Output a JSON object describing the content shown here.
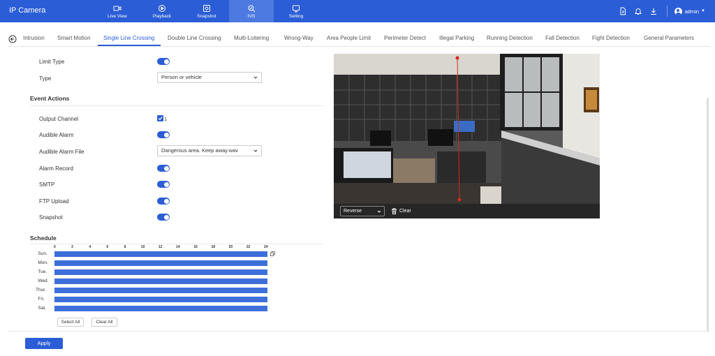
{
  "app": {
    "title": "IP Camera"
  },
  "nav": [
    {
      "label": "Live View",
      "icon": "video-icon"
    },
    {
      "label": "Playback",
      "icon": "playback-icon"
    },
    {
      "label": "Snapshot",
      "icon": "snapshot-icon"
    },
    {
      "label": "IVS",
      "icon": "ivs-icon",
      "active": true
    },
    {
      "label": "Setting",
      "icon": "settings-icon"
    }
  ],
  "user": {
    "name": "admin"
  },
  "tabs": [
    {
      "label": "Intrusion"
    },
    {
      "label": "Smart Motion"
    },
    {
      "label": "Single Line Crossing",
      "active": true
    },
    {
      "label": "Double Line Crossing"
    },
    {
      "label": "Multi-Loitering"
    },
    {
      "label": "Wrong-Way"
    },
    {
      "label": "Area People Limit"
    },
    {
      "label": "Perimeter Detect"
    },
    {
      "label": "Illegal Parking"
    },
    {
      "label": "Running Detection"
    },
    {
      "label": "Fall Detection"
    },
    {
      "label": "Fight Detection"
    },
    {
      "label": "General Parameters"
    }
  ],
  "form": {
    "limit_type_label": "Limit Type",
    "limit_type_on": true,
    "type_label": "Type",
    "type_value": "Person or vehicle",
    "event_actions_title": "Event Actions",
    "output_channel_label": "Output Channel",
    "output_channel_value": "1",
    "audible_alarm_label": "Audible Alarm",
    "audible_alarm_on": true,
    "audible_alarm_file_label": "Audible Alarm File",
    "audible_alarm_file_value": "Dangerous area. Keep away.wav",
    "alarm_record_label": "Alarm Record",
    "alarm_record_on": true,
    "smtp_label": "SMTP",
    "smtp_on": true,
    "ftp_label": "FTP Upload",
    "ftp_on": true,
    "snapshot_label": "Snapshot",
    "snapshot_on": true
  },
  "schedule": {
    "title": "Schedule",
    "hours": [
      "0",
      "2",
      "4",
      "6",
      "8",
      "10",
      "12",
      "14",
      "16",
      "18",
      "20",
      "22",
      "24"
    ],
    "days": [
      "Sun.",
      "Mon.",
      "Tue.",
      "Wed.",
      "Thur.",
      "Fri.",
      "Sat."
    ],
    "select_all": "Select All",
    "clear_all": "Clear All"
  },
  "video": {
    "direction_value": "Reverse",
    "clear_label": "Clear"
  },
  "apply_label": "Apply",
  "colors": {
    "accent": "#2b5dd6",
    "schedule_bar": "#3c6fd9",
    "line": "#d62a1e"
  }
}
